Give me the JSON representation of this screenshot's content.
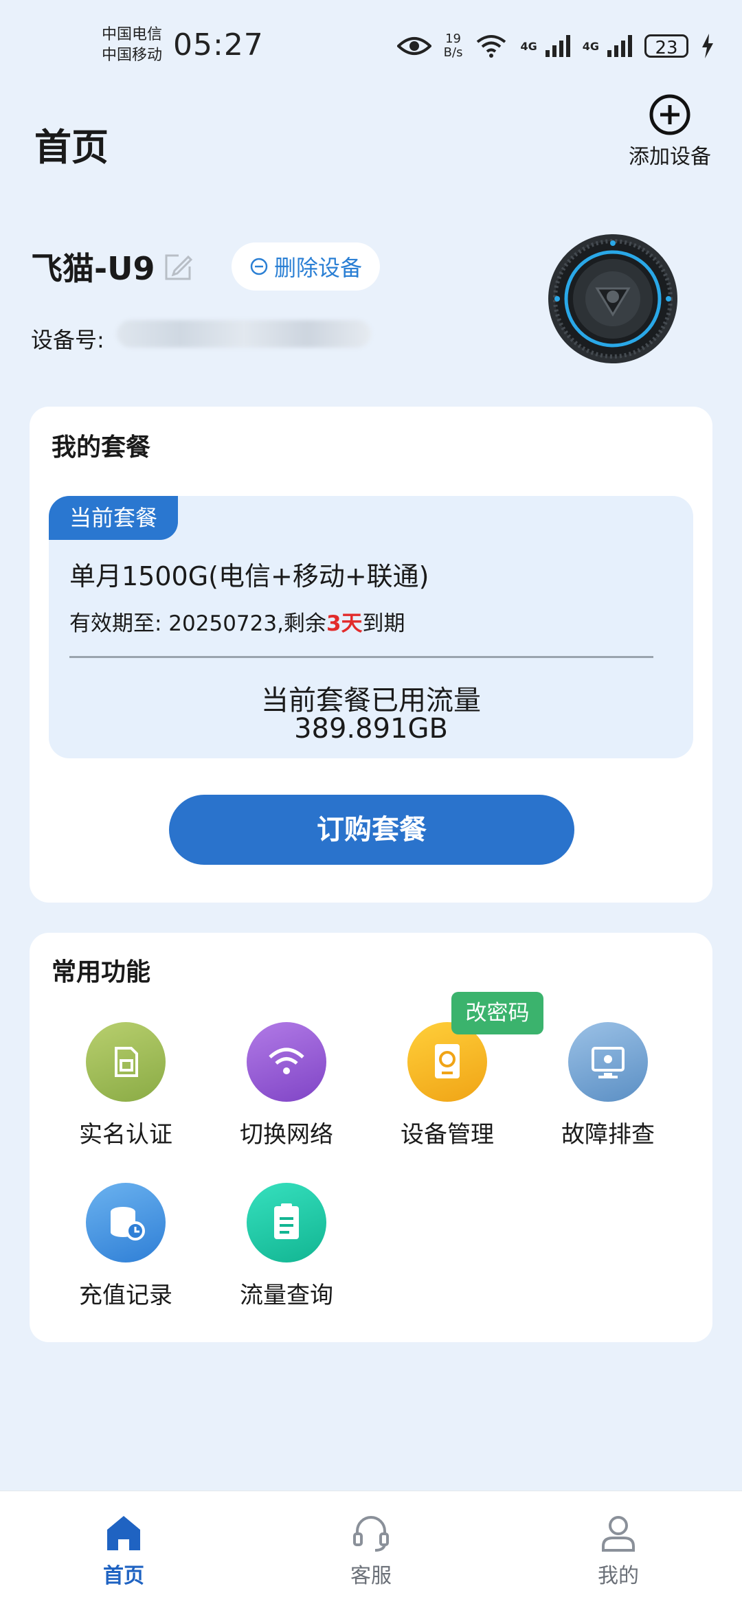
{
  "status_bar": {
    "carrier_1": "中国电信",
    "carrier_2": "中国移动",
    "time": "05:27",
    "net_speed_value": "19",
    "net_speed_unit": "B/s",
    "signal_1": "4G",
    "signal_2": "4G",
    "battery": "23"
  },
  "header": {
    "title": "首页",
    "add_device_label": "添加设备"
  },
  "device": {
    "name": "飞猫-U9",
    "delete_label": "删除设备",
    "number_label": "设备号:"
  },
  "my_plan": {
    "section_title": "我的套餐",
    "current_tag": "当前套餐",
    "plan_name": "单月1500G(电信+移动+联通)",
    "expiry_prefix": "有效期至: 20250723,剩余",
    "days_left": "3天",
    "expiry_suffix": "到期",
    "usage_label": "当前套餐已用流量",
    "usage_value": "389.891GB",
    "buy_button": "订购套餐"
  },
  "functions": {
    "section_title": "常用功能",
    "badge": "改密码",
    "items": [
      {
        "label": "实名认证",
        "icon": "sim-card-icon",
        "color": "#9bbb59"
      },
      {
        "label": "切换网络",
        "icon": "wifi-icon",
        "color": "#9a5cd4"
      },
      {
        "label": "设备管理",
        "icon": "device-manage-icon",
        "color": "#f5b21a"
      },
      {
        "label": "故障排查",
        "icon": "troubleshoot-icon",
        "color": "#6a9fd0"
      },
      {
        "label": "充值记录",
        "icon": "recharge-record-icon",
        "color": "#3f8fe0"
      },
      {
        "label": "流量查询",
        "icon": "data-query-icon",
        "color": "#1fc7a4"
      }
    ]
  },
  "bottom_nav": {
    "home": "首页",
    "service": "客服",
    "mine": "我的",
    "active_color": "#1f63c2"
  }
}
